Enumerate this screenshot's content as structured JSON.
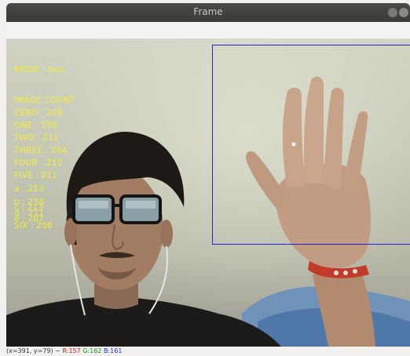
{
  "window": {
    "title": "Frame"
  },
  "overlay": {
    "mode": "MODE : test",
    "image_count_label": "IMAGE COUNT",
    "counts": [
      "ZERO : 208",
      "ONE : 199",
      "TWO : 211",
      "THREE : 204",
      "FOUR : 210",
      "FIVE : 211",
      "a : 213",
      "b : 258",
      "c : 213",
      "d : 211",
      "e : 207",
      "SIX : 206"
    ]
  },
  "status": {
    "coords": "(x=391, y=79) ~",
    "r": "R:157",
    "g": "G:162",
    "b": "B:161"
  },
  "colors": {
    "overlay_text": "#f0ee3a",
    "roi_box": "#2424d6",
    "titlebar": "#3b3a37"
  }
}
